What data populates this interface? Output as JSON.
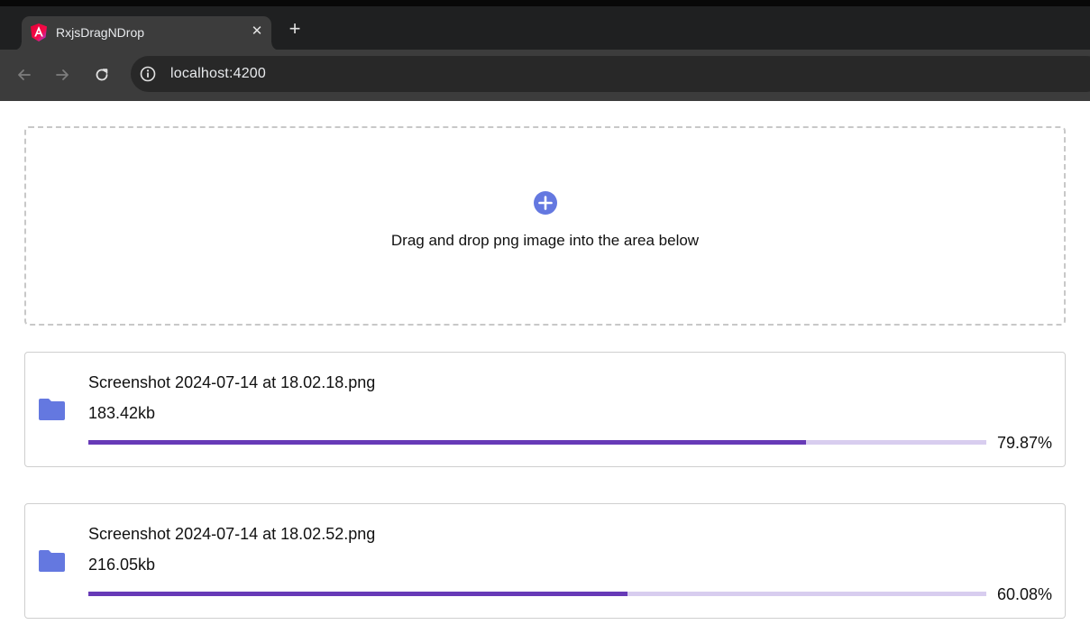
{
  "browser": {
    "tab": {
      "title": "RxjsDragNDrop",
      "favicon": "angular-logo-icon",
      "close_icon": "close-icon"
    },
    "new_tab_icon": "plus-icon",
    "nav": {
      "back_icon": "arrow-left-icon",
      "forward_icon": "arrow-right-icon",
      "reload_icon": "reload-icon"
    },
    "address_bar": {
      "url": "localhost:4200",
      "site_info_icon": "info-circle-icon"
    }
  },
  "dropzone": {
    "icon": "add-circle-icon",
    "instruction": "Drag and drop png image into the area below",
    "accent_color": "#6478e0"
  },
  "files": [
    {
      "name": "Screenshot 2024-07-14 at 18.02.18.png",
      "size": "183.42kb",
      "progress_label": "79.87%",
      "progress": 0.7987,
      "icon": "folder-icon"
    },
    {
      "name": "Screenshot 2024-07-14 at 18.02.52.png",
      "size": "216.05kb",
      "progress_label": "60.08%",
      "progress": 0.6008,
      "icon": "folder-icon"
    }
  ],
  "colors": {
    "progress_fill": "#673ab7",
    "progress_track": "#d8cdef",
    "folder": "#6478e0"
  }
}
